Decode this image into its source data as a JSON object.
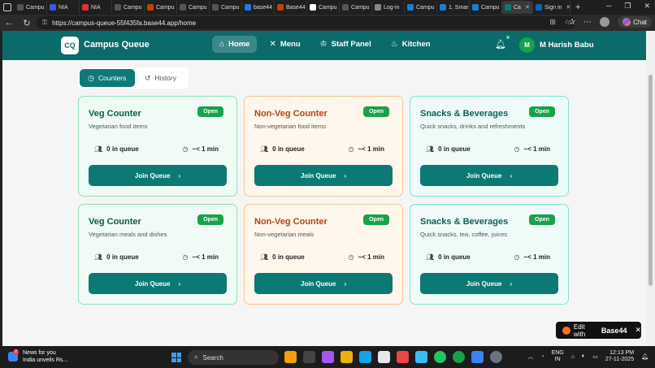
{
  "browser": {
    "tabs": [
      {
        "label": "Campu",
        "color": "#555"
      },
      {
        "label": "NIA",
        "color": "#3b5bdb"
      },
      {
        "label": "NIA",
        "color": "#e03131"
      },
      {
        "label": "Campu",
        "color": "#555"
      },
      {
        "label": "Campu",
        "color": "#c2410c"
      },
      {
        "label": "Campu",
        "color": "#555"
      },
      {
        "label": "Campu",
        "color": "#555"
      },
      {
        "label": "base44",
        "color": "#1c7ed6"
      },
      {
        "label": "Base44",
        "color": "#c2410c"
      },
      {
        "label": "Campu",
        "color": "#fff"
      },
      {
        "label": "Campu",
        "color": "#555"
      },
      {
        "label": "Log-in",
        "color": "#888"
      },
      {
        "label": "Campu",
        "color": "#1c7ed6"
      },
      {
        "label": "1. Smar",
        "color": "#1c7ed6"
      },
      {
        "label": "Campu",
        "color": "#1c7ed6"
      },
      {
        "label": "Ca",
        "color": "#0b7a74",
        "active": true
      },
      {
        "label": "Sign in",
        "color": "#0a66c2"
      }
    ],
    "url": "https://campus-queue-55f435fa.base44.app/home",
    "copilot_label": "Chat"
  },
  "header": {
    "logo": "CQ",
    "brand": "Campus Queue",
    "nav": [
      {
        "label": "Home",
        "icon": "home-icon",
        "glyph": "⌂",
        "active": true
      },
      {
        "label": "Menu",
        "icon": "utensils-icon",
        "glyph": "✕"
      },
      {
        "label": "Staff Panel",
        "icon": "chef-hat-icon",
        "glyph": "♔"
      },
      {
        "label": "Kitchen",
        "icon": "flame-icon",
        "glyph": "♨"
      }
    ],
    "user_initial": "M",
    "user_name": "M Harish Babu"
  },
  "tabs": {
    "counters": "Counters",
    "history": "History"
  },
  "counters": [
    {
      "title": "Veg Counter",
      "desc": "Vegetarian food items",
      "status": "Open",
      "queue": "0 in queue",
      "wait": "~< 1 min",
      "cta": "Join Queue",
      "kind": "veg"
    },
    {
      "title": "Non-Veg Counter",
      "desc": "Non-vegetarian food items",
      "status": "Open",
      "queue": "0 in queue",
      "wait": "~< 1 min",
      "cta": "Join Queue",
      "kind": "nonveg"
    },
    {
      "title": "Snacks & Beverages",
      "desc": "Quick snacks, drinks and refreshments",
      "status": "Open",
      "queue": "0 in queue",
      "wait": "~< 1 min",
      "cta": "Join Queue",
      "kind": "snack"
    },
    {
      "title": "Veg Counter",
      "desc": "Vegetarian meals and dishes",
      "status": "Open",
      "queue": "0 in queue",
      "wait": "~< 1 min",
      "cta": "Join Queue",
      "kind": "veg"
    },
    {
      "title": "Non-Veg Counter",
      "desc": "Non-vegetarian meals",
      "status": "Open",
      "queue": "0 in queue",
      "wait": "~< 1 min",
      "cta": "Join Queue",
      "kind": "nonveg"
    },
    {
      "title": "Snacks & Beverages",
      "desc": "Quick snacks, tea, coffee, juices",
      "status": "Open",
      "queue": "0 in queue",
      "wait": "~< 1 min",
      "cta": "Join Queue",
      "kind": "snack"
    }
  ],
  "badge": {
    "label": "Edit with",
    "brand": "Base44"
  },
  "taskbar": {
    "news_title": "News for you",
    "news_sub": "India unveils Rs...",
    "news_count": "2",
    "search": "Search",
    "lang1": "ENG",
    "lang2": "IN",
    "time": "12:13 PM",
    "date": "27-11-2025"
  }
}
